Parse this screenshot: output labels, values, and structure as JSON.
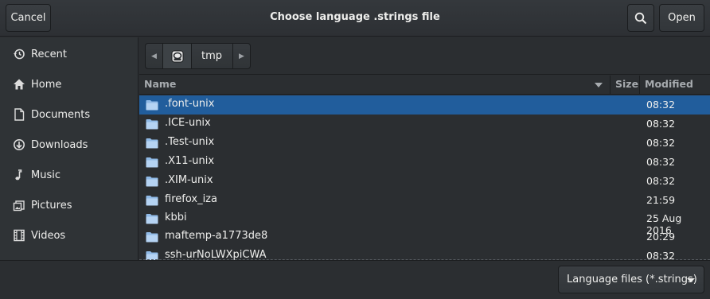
{
  "header": {
    "title": "Choose language .strings file",
    "cancel_label": "Cancel",
    "open_label": "Open",
    "search_icon": "search-icon"
  },
  "sidebar": {
    "items": [
      {
        "label": "Recent",
        "icon": "recent-icon"
      },
      {
        "label": "Home",
        "icon": "home-icon"
      },
      {
        "label": "Documents",
        "icon": "documents-icon"
      },
      {
        "label": "Downloads",
        "icon": "downloads-icon"
      },
      {
        "label": "Music",
        "icon": "music-icon"
      },
      {
        "label": "Pictures",
        "icon": "pictures-icon"
      },
      {
        "label": "Videos",
        "icon": "videos-icon"
      }
    ]
  },
  "pathbar": {
    "current": "tmp",
    "root_icon": "drive-icon"
  },
  "columns": {
    "name": "Name",
    "size": "Size",
    "modified": "Modified"
  },
  "files": [
    {
      "name": ".font-unix",
      "modified": "08:32",
      "selected": true
    },
    {
      "name": ".ICE-unix",
      "modified": "08:32"
    },
    {
      "name": ".Test-unix",
      "modified": "08:32"
    },
    {
      "name": ".X11-unix",
      "modified": "08:32"
    },
    {
      "name": ".XIM-unix",
      "modified": "08:32"
    },
    {
      "name": "firefox_iza",
      "modified": "21:59"
    },
    {
      "name": "kbbi",
      "modified": "25 Aug 2016"
    },
    {
      "name": "maftemp-a1773de8",
      "modified": "20:29"
    },
    {
      "name": "ssh-urNoLWXpiCWA",
      "modified": "08:32"
    }
  ],
  "footer": {
    "filter_label": "Language files (*.strings)"
  },
  "colors": {
    "selection": "#215d9c",
    "background": "#2b2e31",
    "folder": "#8fb9e6"
  }
}
